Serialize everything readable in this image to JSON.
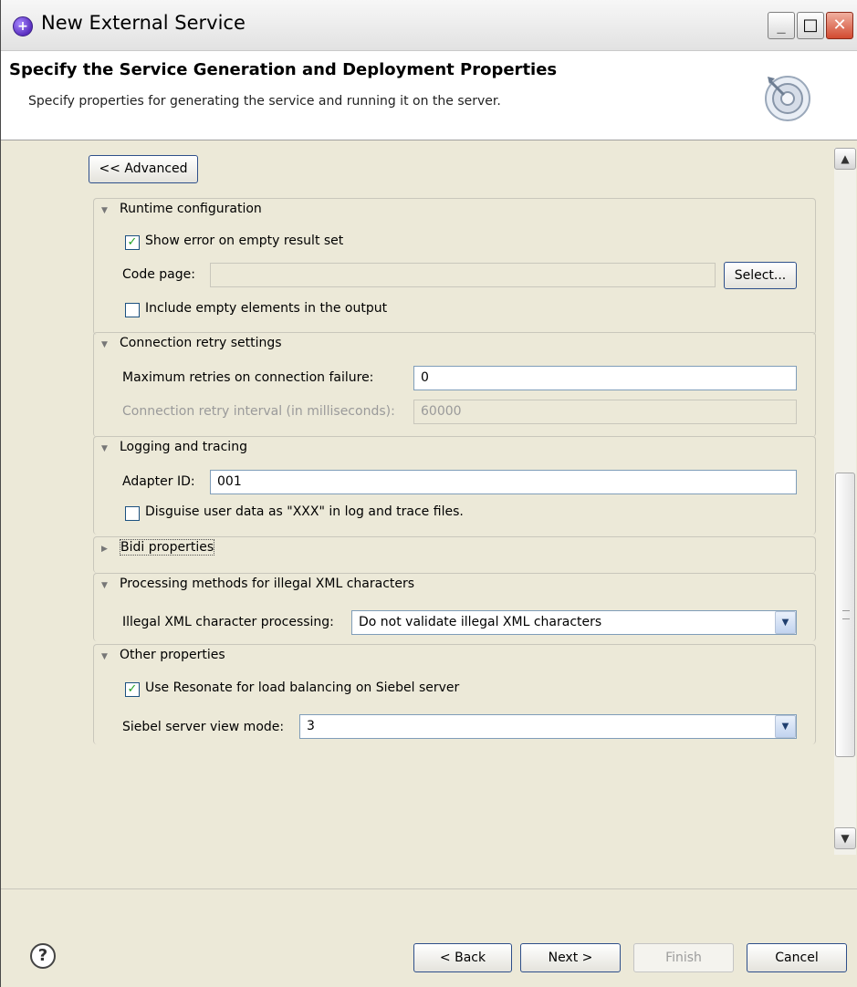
{
  "window": {
    "title": "New External Service"
  },
  "header": {
    "title": "Specify the Service Generation and Deployment Properties",
    "description": "Specify properties for generating the service and running it on the server."
  },
  "advanced_button": "<< Advanced",
  "runtime": {
    "heading": "Runtime configuration",
    "show_error": {
      "label": "Show error on empty result set",
      "checked": true
    },
    "code_page": {
      "label": "Code page:",
      "value": "",
      "select_label": "Select..."
    },
    "include_empty": {
      "label": "Include empty elements in the output",
      "checked": false
    }
  },
  "retry": {
    "heading": "Connection retry settings",
    "max_retries": {
      "label": "Maximum retries on connection failure:",
      "value": "0"
    },
    "interval": {
      "label": "Connection retry interval (in milliseconds):",
      "value": "60000"
    }
  },
  "logging": {
    "heading": "Logging and tracing",
    "adapter_id": {
      "label": "Adapter ID:",
      "value": "001"
    },
    "disguise": {
      "label": "Disguise user data as \"XXX\" in log and trace files.",
      "checked": false
    }
  },
  "bidi": {
    "heading": "Bidi properties"
  },
  "illegal_xml": {
    "heading": "Processing methods for illegal XML characters",
    "processing": {
      "label": "Illegal XML character processing:",
      "value": "Do not validate illegal XML characters"
    }
  },
  "other": {
    "heading": "Other properties",
    "resonate": {
      "label": "Use Resonate for load balancing on Siebel server",
      "checked": true
    },
    "view_mode": {
      "label": "Siebel server view mode:",
      "value": "3"
    }
  },
  "footer": {
    "back": "< Back",
    "next": "Next >",
    "finish": "Finish",
    "cancel": "Cancel"
  },
  "icons": {
    "check_mark": "✓",
    "help": "?"
  }
}
